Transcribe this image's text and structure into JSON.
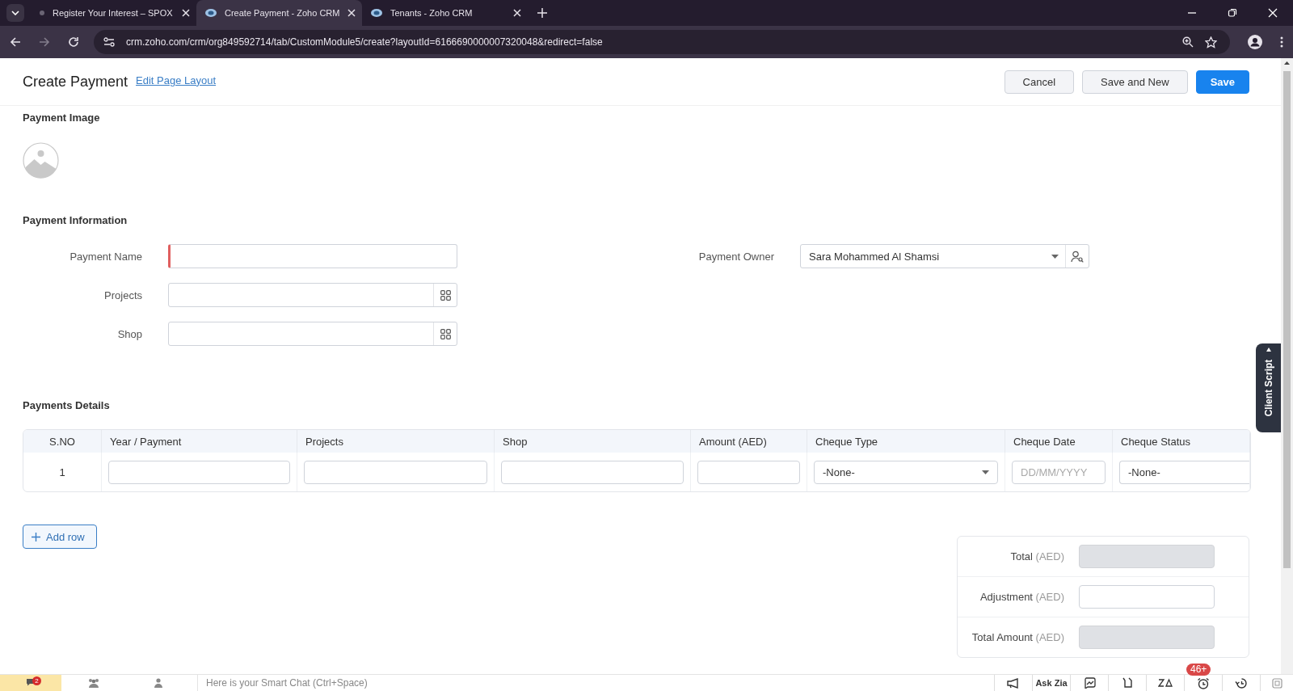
{
  "browser": {
    "tabs": [
      {
        "title": "Register Your Interest – SPOX",
        "selected": false
      },
      {
        "title": "Create Payment - Zoho CRM",
        "selected": true
      },
      {
        "title": "Tenants - Zoho CRM",
        "selected": false
      }
    ],
    "url": "crm.zoho.com/crm/org849592714/tab/CustomModule5/create?layoutId=6166690000007320048&redirect=false"
  },
  "header": {
    "title": "Create Payment",
    "edit_link": "Edit Page Layout",
    "buttons": [
      {
        "label": "Cancel",
        "kind": "secondary"
      },
      {
        "label": "Save and New",
        "kind": "secondary"
      },
      {
        "label": "Save",
        "kind": "primary"
      }
    ]
  },
  "image_section": {
    "title": "Payment Image"
  },
  "info_section": {
    "title": "Payment Information",
    "left_fields": [
      {
        "label": "Payment Name",
        "kind": "text",
        "required": true
      },
      {
        "label": "Projects",
        "kind": "lookup",
        "required": false
      },
      {
        "label": "Shop",
        "kind": "lookup",
        "required": false
      }
    ],
    "right_fields": [
      {
        "label": "Payment Owner",
        "kind": "owner",
        "value": "Sara Mohammed Al Shamsi",
        "required": false
      }
    ]
  },
  "details_section": {
    "title": "Payments Details",
    "columns": [
      "S.NO",
      "Year / Payment",
      "Projects",
      "Shop",
      "Amount (AED)",
      "Cheque Type",
      "Cheque Date",
      "Cheque Status"
    ],
    "rows": [
      {
        "cells": [
          {
            "kind": "number",
            "value": "1"
          },
          {
            "kind": "text"
          },
          {
            "kind": "text"
          },
          {
            "kind": "text"
          },
          {
            "kind": "text"
          },
          {
            "kind": "select",
            "value": "-None-"
          },
          {
            "kind": "date",
            "placeholder": "DD/MM/YYYY"
          },
          {
            "kind": "select-cut",
            "value": "-None-"
          }
        ]
      }
    ],
    "add_row": "Add row"
  },
  "totals": [
    {
      "label": "Total",
      "unit": "(AED)",
      "readonly": true
    },
    {
      "label": "Adjustment",
      "unit": "(AED)",
      "readonly": false
    },
    {
      "label": "Total Amount",
      "unit": "(AED)",
      "readonly": true
    }
  ],
  "client_script": "Client Script",
  "bottom_bar": {
    "unread_badge": "2",
    "smart_chat_placeholder": "Here is your Smart Chat (Ctrl+Space)",
    "ask_zia": "Ask Zia",
    "reminder_badge": "46+"
  }
}
